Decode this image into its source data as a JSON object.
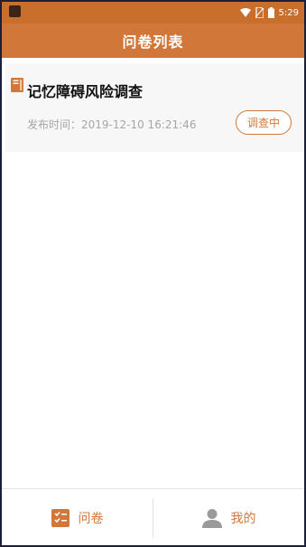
{
  "statusbar": {
    "time": "5:29"
  },
  "header": {
    "title": "问卷列表"
  },
  "surveys": [
    {
      "title": "记忆障碍风险调查",
      "date_text": "发布时间：2019-12-10 16:21:46",
      "status": "调查中"
    }
  ],
  "bottom_nav": [
    {
      "label": "问卷",
      "icon": "survey-checklist-icon"
    },
    {
      "label": "我的",
      "icon": "person-icon"
    }
  ],
  "colors": {
    "accent": "#d1773a",
    "statusbar": "#c96f2e"
  }
}
